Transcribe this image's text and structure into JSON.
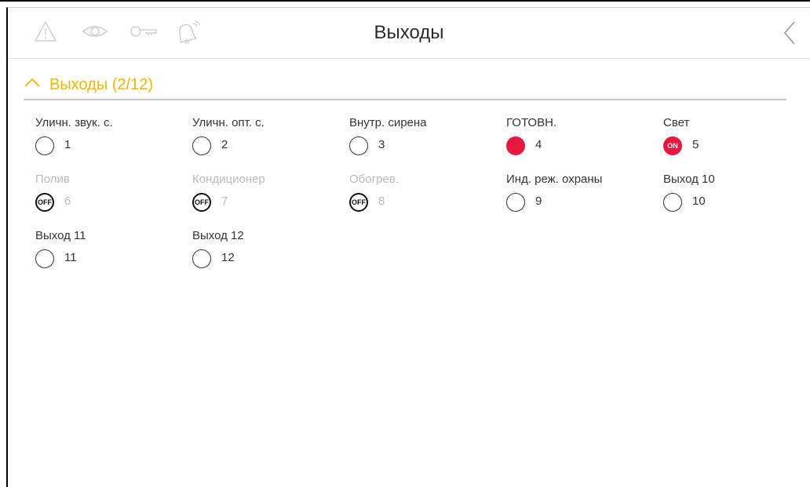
{
  "header": {
    "title": "Выходы",
    "icons": [
      "warning-icon",
      "eye-icon",
      "key-icon",
      "bell-icon"
    ],
    "back_icon": "chevron-left-icon"
  },
  "section": {
    "title": "Выходы (2/12)",
    "expanded": true,
    "accent": "#f4b400"
  },
  "colors": {
    "on": "#e8173d",
    "disabled_text": "#b9b9b9",
    "text": "#333333"
  },
  "outputs": [
    {
      "label": "Уличн. звук. с.",
      "number": "1",
      "state": "off"
    },
    {
      "label": "Уличн. опт. с.",
      "number": "2",
      "state": "off"
    },
    {
      "label": "Внутр. сирена",
      "number": "3",
      "state": "off"
    },
    {
      "label": "ГОТОВН.",
      "number": "4",
      "state": "on"
    },
    {
      "label": "Свет",
      "number": "5",
      "state": "on-badge",
      "badge": "ON"
    },
    {
      "label": "Полив",
      "number": "6",
      "state": "off-badge",
      "badge": "OFF",
      "disabled": true
    },
    {
      "label": "Кондиционер",
      "number": "7",
      "state": "off-badge",
      "badge": "OFF",
      "disabled": true
    },
    {
      "label": "Обогрев.",
      "number": "8",
      "state": "off-badge",
      "badge": "OFF",
      "disabled": true
    },
    {
      "label": "Инд. реж. охраны",
      "number": "9",
      "state": "off"
    },
    {
      "label": "Выход 10",
      "number": "10",
      "state": "off"
    },
    {
      "label": "Выход 11",
      "number": "11",
      "state": "off"
    },
    {
      "label": "Выход 12",
      "number": "12",
      "state": "off"
    }
  ]
}
